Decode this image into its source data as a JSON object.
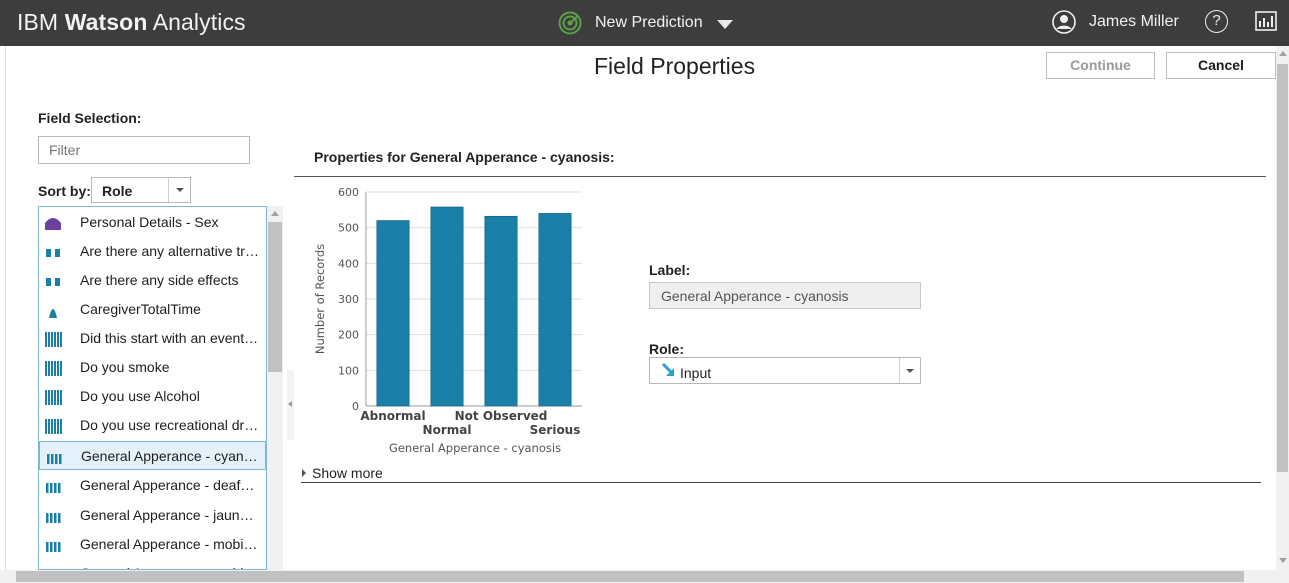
{
  "topbar": {
    "brand_light": "IBM ",
    "brand_bold": "Watson",
    "brand_rest": " Analytics",
    "prediction_title": "New Prediction",
    "user_name": "James Miller",
    "help_glyph": "?"
  },
  "page": {
    "title": "Field Properties",
    "continue_label": "Continue",
    "cancel_label": "Cancel"
  },
  "field_selection": {
    "label": "Field Selection:",
    "filter_placeholder": "Filter",
    "sort_label": "Sort by:",
    "sort_value": "Role",
    "items": [
      {
        "label": "Personal Details - Sex",
        "icon": "categorical-icon",
        "selected": false
      },
      {
        "label": "Are there any alternative tr…",
        "icon": "binary-icon",
        "selected": false
      },
      {
        "label": "Are there any side effects",
        "icon": "binary-icon",
        "selected": false
      },
      {
        "label": "CaregiverTotalTime",
        "icon": "continuous-icon",
        "selected": false
      },
      {
        "label": "Did this start with an event…",
        "icon": "multi-category-icon",
        "selected": false
      },
      {
        "label": "Do you smoke",
        "icon": "multi-category-icon",
        "selected": false
      },
      {
        "label": "Do you use Alcohol",
        "icon": "multi-category-icon",
        "selected": false
      },
      {
        "label": "Do you use recreational dr…",
        "icon": "multi-category-icon",
        "selected": false
      },
      {
        "label": "General Apperance - cyano…",
        "icon": "ordinal-icon",
        "selected": true
      },
      {
        "label": "General Apperance - deafn…",
        "icon": "ordinal-icon",
        "selected": false
      },
      {
        "label": "General Apperance - jaundi…",
        "icon": "ordinal-icon",
        "selected": false
      },
      {
        "label": "General Apperance - mobili…",
        "icon": "ordinal-icon",
        "selected": false
      },
      {
        "label": "General Apperance - mobili…",
        "icon": "ordinal-icon",
        "selected": false
      }
    ]
  },
  "properties": {
    "heading": "Properties for General Apperance - cyanosis:",
    "label_caption": "Label:",
    "label_value": "General Apperance - cyanosis",
    "role_caption": "Role:",
    "role_value": "Input",
    "show_more": "Show more"
  },
  "chart_data": {
    "type": "bar",
    "categories": [
      "Abnormal",
      "Normal",
      "Not Observed",
      "Serious"
    ],
    "values": [
      520,
      558,
      532,
      540
    ],
    "xlabel": "General Apperance - cyanosis",
    "ylabel": "Number of Records",
    "ylim": [
      0,
      600
    ],
    "yticks": [
      0,
      100,
      200,
      300,
      400,
      500,
      600
    ],
    "grid": true,
    "bar_color": "#1a7fa6"
  }
}
